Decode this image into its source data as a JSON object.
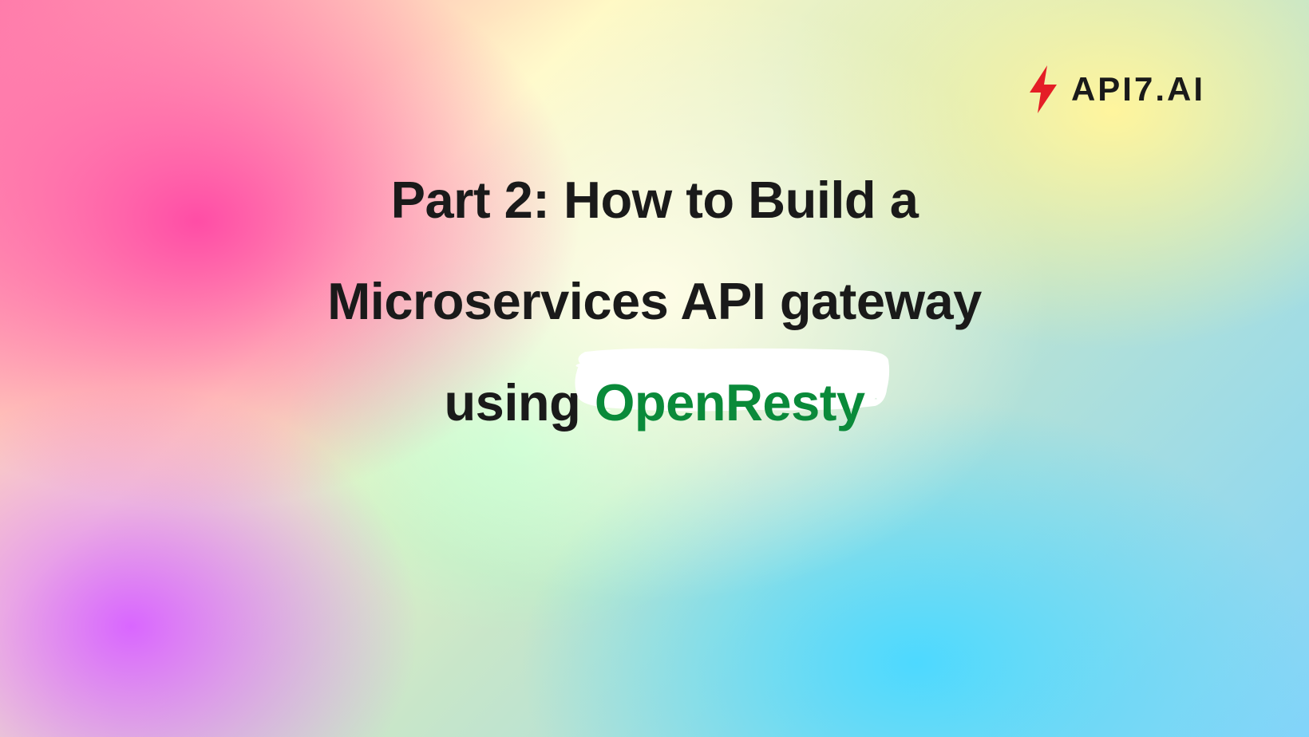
{
  "logo": {
    "brand_text": "API7.AI",
    "bolt_color": "#e41e26"
  },
  "title": {
    "line1": "Part 2: How to Build a",
    "line2": "Microservices API gateway",
    "line3_prefix": "using ",
    "line3_highlight": "OpenResty"
  },
  "colors": {
    "title_color": "#1a1a1a",
    "highlight_color": "#0a8a3a",
    "highlight_bg": "#ffffff"
  }
}
